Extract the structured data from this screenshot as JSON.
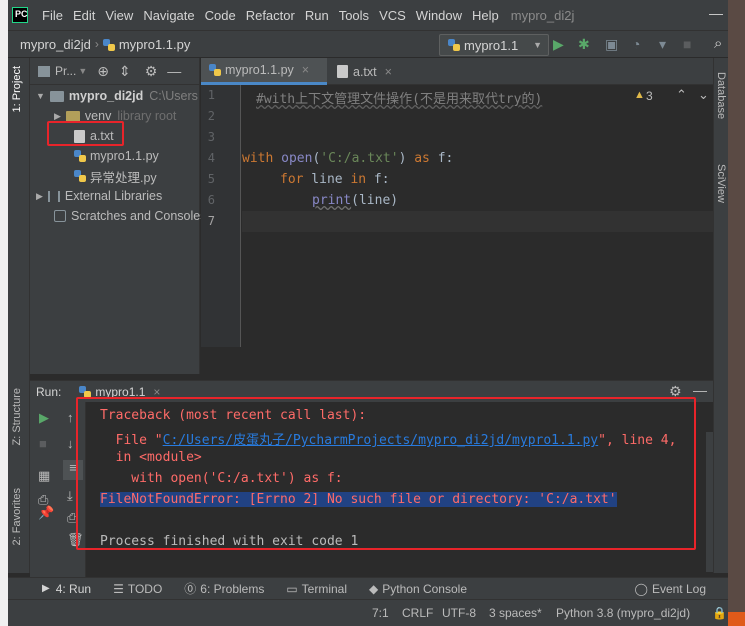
{
  "window": {
    "menu": [
      "File",
      "Edit",
      "View",
      "Navigate",
      "Code",
      "Refactor",
      "Run",
      "Tools",
      "VCS",
      "Window",
      "Help"
    ],
    "title": "mypro_di2j"
  },
  "nav": {
    "project": "mypro_di2jd",
    "file": "mypro1.1.py",
    "run_config": "mypro1.1"
  },
  "project_panel": {
    "title": "Pr...",
    "tree": [
      {
        "label": "mypro_di2jd",
        "hint": "C:\\Users",
        "bold": true
      },
      {
        "label": "venv",
        "hint": "library root"
      },
      {
        "label": "a.txt"
      },
      {
        "label": "mypro1.1.py"
      },
      {
        "label": "异常处理.py"
      },
      {
        "label": "External Libraries"
      },
      {
        "label": "Scratches and Consoles"
      }
    ]
  },
  "editor": {
    "tabs": [
      {
        "label": "mypro1.1.py",
        "active": true
      },
      {
        "label": "a.txt",
        "active": false
      }
    ],
    "line_numbers": [
      "1",
      "2",
      "3",
      "4",
      "5",
      "6",
      "7"
    ],
    "code": {
      "l1": "#with上下文管理文件操作(不是用来取代try的)",
      "l4_kw": "with",
      "l4_fn": "open",
      "l4_p1": "(",
      "l4_str": "'C:/a.txt'",
      "l4_p2": ")",
      "l4_as": "as",
      "l4_var": " f:",
      "l5_kw": "for",
      "l5_mid": " line ",
      "l5_in": "in",
      "l5_end": " f:",
      "l6_fn": "print",
      "l6_end": "(line)"
    },
    "warnings": "3"
  },
  "right_tabs": [
    "Database",
    "SciView"
  ],
  "left_tabs": [
    "1: Project",
    "Z: Structure",
    "2: Favorites"
  ],
  "run": {
    "label": "Run:",
    "config": "mypro1.1",
    "output": [
      "Traceback (most recent call last):",
      "  File \"",
      "C:/Users/皮蛋丸子/PycharmProjects/mypro_di2jd/mypro1.1.py",
      "\", line 4,",
      "  in <module>",
      "    with open('C:/a.txt') as f:",
      "FileNotFoundError: [Errno 2] No such file or directory: 'C:/a.txt'",
      "Process finished with exit code 1"
    ]
  },
  "bottom_tools": [
    "4: Run",
    "TODO",
    "6: Problems",
    "Terminal",
    "Python Console",
    "Event Log"
  ],
  "status": {
    "position": "7:1",
    "line_sep": "CRLF",
    "encoding": "UTF-8",
    "indent": "3 spaces*",
    "interpreter": "Python 3.8 (mypro_di2jd)"
  },
  "colors": {
    "error_text": "#ff6b68",
    "highlight_box": "#e8242a",
    "selection": "#214283"
  }
}
